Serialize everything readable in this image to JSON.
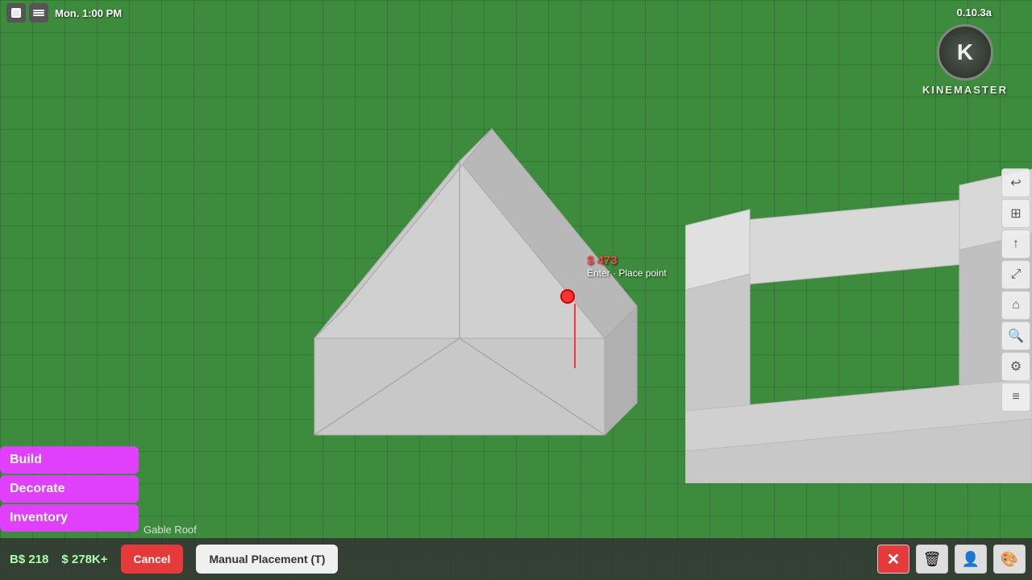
{
  "topbar": {
    "time": "Mon. 1:00 PM",
    "version": "0.10.3a"
  },
  "kinemaster": {
    "logo_letter": "K",
    "brand_name": "KINEMASTER"
  },
  "tooltip": {
    "price": "$ 473",
    "hint": "Enter · Place point"
  },
  "sidebar": {
    "build_label": "Build",
    "decorate_label": "Decorate",
    "inventory_label": "Inventory"
  },
  "bottombar": {
    "currency_label": "B$",
    "cash_amount": "218",
    "bank_prefix": "$",
    "bank_amount": "278K+"
  },
  "placement": {
    "item_name": "Gable Roof",
    "cancel_label": "Cancel",
    "manual_label": "Manual Placement (T)"
  },
  "right_toolbar": {
    "undo_icon": "↩",
    "grid_icon": "⊞",
    "up_icon": "↑",
    "resize_icon": "⤢",
    "home_icon": "⌂",
    "zoom_icon": "🔍",
    "settings_icon": "⚙",
    "more_icon": "≡"
  },
  "bottom_right": {
    "close_icon": "✕",
    "trash_icon": "🗑",
    "person_icon": "👤",
    "palette_icon": "🎨"
  }
}
